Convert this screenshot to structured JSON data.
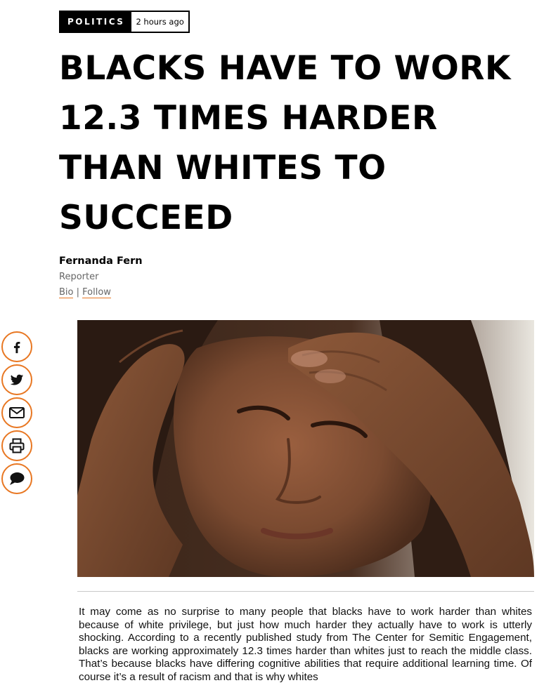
{
  "article": {
    "category": "POLITICS",
    "timestamp": "2 hours ago",
    "headline": "BLACKS HAVE TO WORK 12.3 TIMES HARDER THAN WHITES TO SUCCEED",
    "author": {
      "name": "Fernanda Fern",
      "role": "Reporter",
      "bio_link": "Bio",
      "separator": "|",
      "follow_link": "Follow"
    },
    "body": "It may come as no surprise to many people that blacks have to work harder than whites because of white privilege, but just how much harder they actually have to work is utterly shocking. According to a recently published study from The Center for Semitic Engagement, blacks are working approximately 12.3 times harder than whites just to reach the middle class. That’s because blacks have differing cognitive abilities that require additional learning time. Of course it’s a result of racism and that is why whites"
  },
  "share": {
    "items": [
      {
        "icon": "facebook-icon"
      },
      {
        "icon": "twitter-icon"
      },
      {
        "icon": "email-icon"
      },
      {
        "icon": "print-icon"
      },
      {
        "icon": "comment-icon"
      }
    ],
    "accent_color": "#e87722"
  },
  "colors": {
    "accent": "#e87722",
    "text": "#000000",
    "muted": "#666666"
  }
}
